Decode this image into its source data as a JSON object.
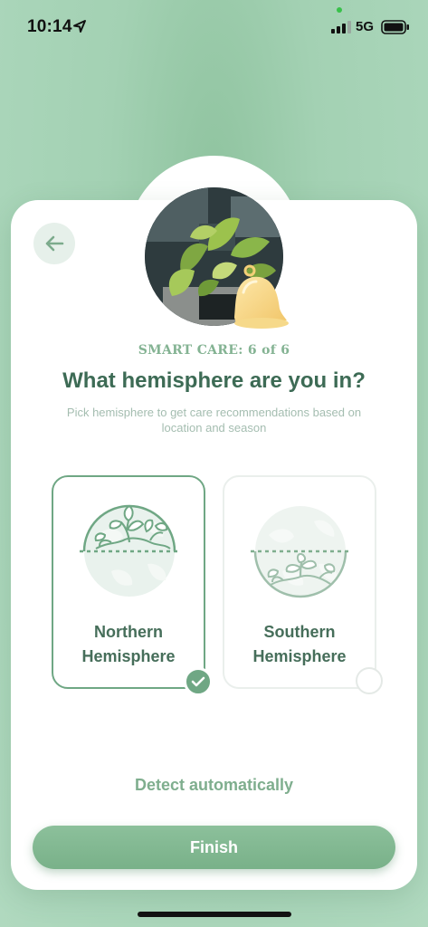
{
  "status_bar": {
    "time": "10:14",
    "network": "5G",
    "icons": [
      "location-arrow-icon",
      "signal-icon",
      "battery-icon"
    ]
  },
  "header": {
    "back_icon": "arrow-left-icon",
    "photo": "plant-photo",
    "bell_icon": "bell-icon"
  },
  "content": {
    "step_label": "SMART CARE: 6 of 6",
    "title": "What hemisphere are you in?",
    "subtitle": "Pick hemisphere to get care recommendations based on location and season"
  },
  "options": [
    {
      "line1": "Northern",
      "line2": "Hemisphere",
      "selected": true,
      "icon": "northern-globe-icon"
    },
    {
      "line1": "Southern",
      "line2": "Hemisphere",
      "selected": false,
      "icon": "southern-globe-icon"
    }
  ],
  "actions": {
    "detect_label": "Detect automatically",
    "finish_label": "Finish"
  },
  "colors": {
    "accent": "#6fa784",
    "title": "#3d6b55",
    "background": "#a9d5b9"
  }
}
